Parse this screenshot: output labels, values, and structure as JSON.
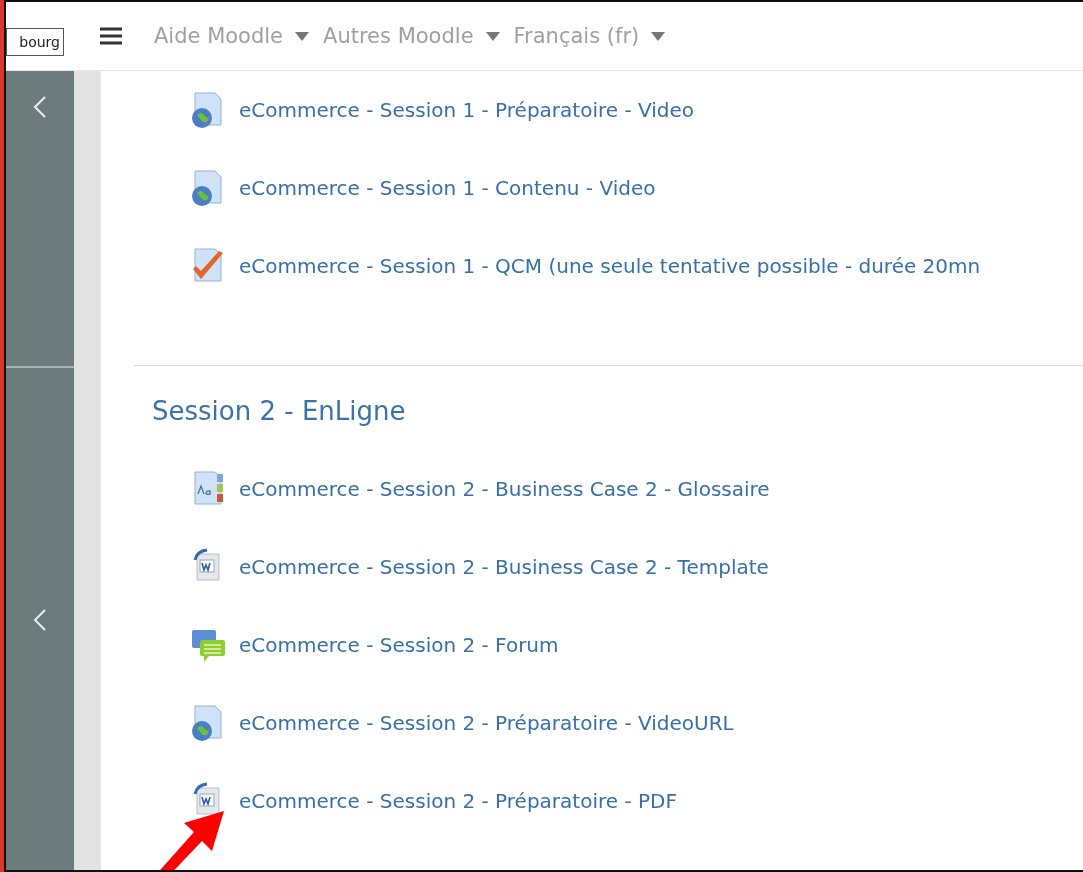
{
  "corner_box": {
    "text": "bourg"
  },
  "navbar": {
    "menus": [
      {
        "label": "Aide Moodle"
      },
      {
        "label": "Autres Moodle"
      },
      {
        "label": "Français (fr)"
      }
    ]
  },
  "sections": [
    {
      "items": [
        {
          "kind": "url",
          "label": "eCommerce - Session 1 - Préparatoire - Video"
        },
        {
          "kind": "url",
          "label": "eCommerce - Session 1 - Contenu - Video"
        },
        {
          "kind": "quiz",
          "label": "eCommerce - Session 1 - QCM (une seule tentative possible - durée 20mn"
        }
      ]
    },
    {
      "title": "Session 2 - EnLigne",
      "items": [
        {
          "kind": "glossary",
          "label": "eCommerce - Session 2 - Business Case 2 - Glossaire"
        },
        {
          "kind": "word",
          "label": "eCommerce - Session 2 - Business Case 2 - Template"
        },
        {
          "kind": "forum",
          "label": "eCommerce - Session 2 - Forum"
        },
        {
          "kind": "url",
          "label": "eCommerce - Session 2 - Préparatoire - VideoURL"
        },
        {
          "kind": "word",
          "label": "eCommerce - Session 2 - Préparatoire - PDF"
        }
      ]
    }
  ]
}
